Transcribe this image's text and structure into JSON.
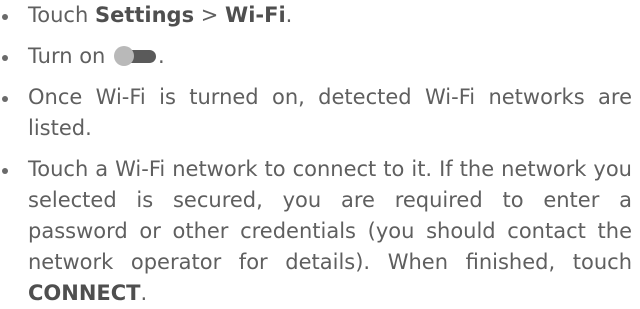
{
  "steps": [
    {
      "parts": {
        "a": "Touch ",
        "b": "Settings",
        "c": " > ",
        "d": "Wi-Fi",
        "e": "."
      }
    },
    {
      "parts": {
        "a": "Turn on ",
        "e": "."
      },
      "toggle_icon": "switch-off-icon"
    },
    {
      "text": "Once Wi-Fi is turned on, detected Wi-Fi networks are listed."
    },
    {
      "text": "Touch a Wi-Fi network to connect to it. If the network you selected is secured, you are required to enter a password or other credentials (you should contact the network operator for details). When finished, touch ",
      "bold_end": "CONNECT",
      "end": "."
    }
  ],
  "colors": {
    "text": "#5f5f5f",
    "bold_text": "#4f4f4f",
    "bullet": "#6a6a6a",
    "toggle_track": "#5a5a5a",
    "toggle_knob": "#b9b9b9",
    "background": "#ffffff"
  }
}
